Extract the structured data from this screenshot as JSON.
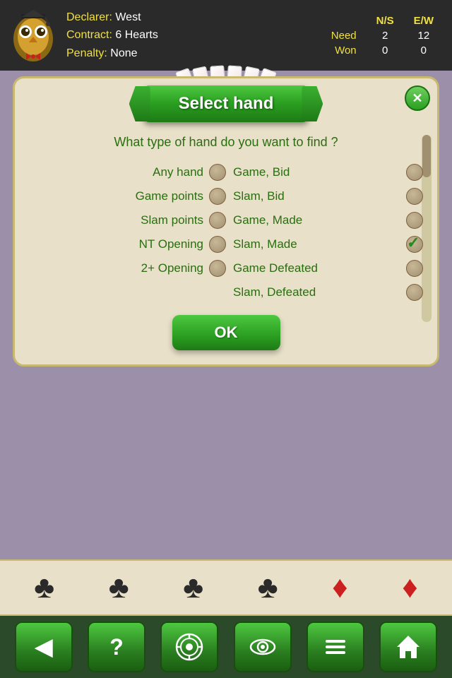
{
  "header": {
    "declarer_label": "Declarer:",
    "declarer_value": "West",
    "contract_label": "Contract:",
    "contract_value": "6 Hearts",
    "penalty_label": "Penalty:",
    "penalty_value": "None",
    "score": {
      "ns_label": "N/S",
      "ew_label": "E/W",
      "need_label": "Need",
      "need_ns": "2",
      "need_ew": "12",
      "won_label": "Won",
      "won_ns": "0",
      "won_ew": "0"
    }
  },
  "dialog": {
    "title": "Select hand",
    "question": "What type of hand do you want to find ?",
    "close_label": "✕",
    "options_left": [
      {
        "id": "any-hand",
        "label": "Any hand",
        "selected": false
      },
      {
        "id": "game-points",
        "label": "Game points",
        "selected": false
      },
      {
        "id": "slam-points",
        "label": "Slam points",
        "selected": false
      },
      {
        "id": "nt-opening",
        "label": "NT Opening",
        "selected": false
      },
      {
        "id": "two-plus-opening",
        "label": "2+ Opening",
        "selected": false
      }
    ],
    "options_right": [
      {
        "id": "game-bid",
        "label": "Game, Bid",
        "selected": false
      },
      {
        "id": "slam-bid",
        "label": "Slam, Bid",
        "selected": false
      },
      {
        "id": "game-made",
        "label": "Game, Made",
        "selected": false
      },
      {
        "id": "slam-made",
        "label": "Slam, Made",
        "selected": true
      },
      {
        "id": "game-defeated",
        "label": "Game Defeated",
        "selected": false
      },
      {
        "id": "slam-defeated",
        "label": "Slam, Defeated",
        "selected": false
      }
    ],
    "ok_label": "OK"
  },
  "suits_bar": {
    "suits": [
      "♣",
      "♣",
      "♣",
      "♣",
      "♦",
      "♦"
    ]
  },
  "toolbar": {
    "buttons": [
      {
        "id": "back",
        "icon": "◀",
        "label": "back-button"
      },
      {
        "id": "help",
        "icon": "?",
        "label": "help-button"
      },
      {
        "id": "chip",
        "icon": "⊙",
        "label": "chip-button"
      },
      {
        "id": "eye",
        "icon": "◎",
        "label": "eye-button"
      },
      {
        "id": "menu",
        "icon": "≡",
        "label": "menu-button"
      },
      {
        "id": "home",
        "icon": "⌂",
        "label": "home-button"
      }
    ]
  }
}
